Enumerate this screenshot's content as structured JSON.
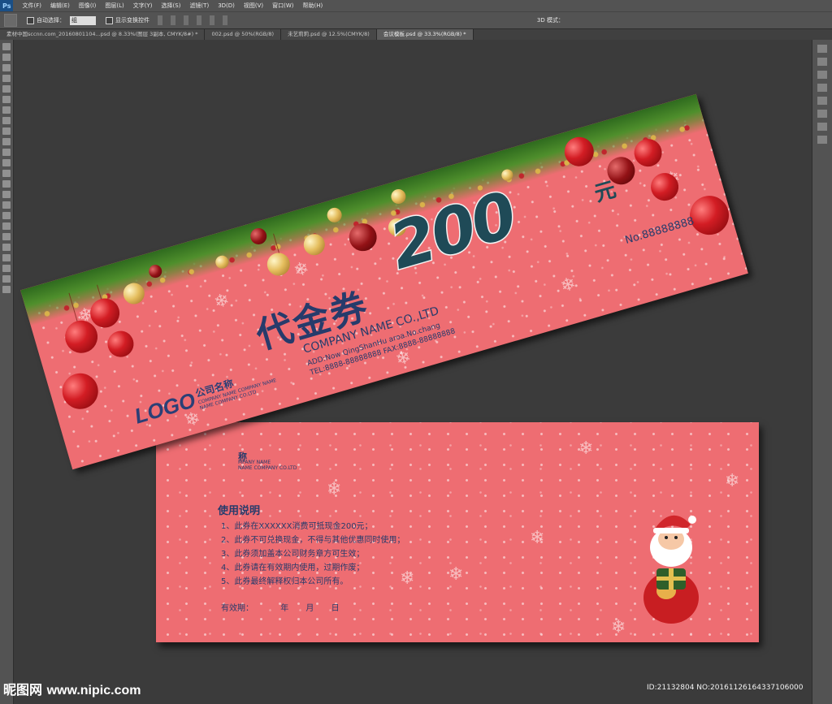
{
  "app": {
    "logo": "Ps",
    "menu": [
      "文件(F)",
      "编辑(E)",
      "图像(I)",
      "图层(L)",
      "文字(Y)",
      "选择(S)",
      "滤镜(T)",
      "3D(D)",
      "视图(V)",
      "窗口(W)",
      "帮助(H)"
    ]
  },
  "options_bar": {
    "auto_select_label": "自动选择：",
    "auto_select_value": "组",
    "show_transform_label": "显示变换控件",
    "mode_3d_label": "3D 模式："
  },
  "tabs": [
    {
      "label": "素材中国sccnn.com_20160801104...psd @ 8.33%(图层 3副本, CMYK/8#) *",
      "active": false
    },
    {
      "label": "002.psd @ 50%(RGB/8)",
      "active": false
    },
    {
      "label": "未艺莉莉.psd @ 12.5%(CMYK/8)",
      "active": false
    },
    {
      "label": "会议模板.psd @ 33.3%(RGB/8) *",
      "active": true
    }
  ],
  "voucher_front": {
    "title": "代金券",
    "amount": "200",
    "unit": "元",
    "serial": "No.88888888",
    "company_en": "COMPANY NAME CO.,LTD",
    "address": "ADD:Now QingShanHu aroa.No.chang",
    "phone_fax": "TEL:8888-88888888   FAX:8888-88888888",
    "logo": "LOGO",
    "logo_company_cn": "公司名称",
    "logo_company_en_1": "COMPANY NAME COMPANY NAME",
    "logo_company_en_2": "NAME COMPANY CO.LTD"
  },
  "voucher_back": {
    "peek_cn": "称",
    "peek_en_1": "MPANY NAME",
    "peek_en_2": "NAME COMPANY CO.LTD",
    "usage_title": "使用说明",
    "rules": [
      "1、此券在XXXXXX消费可抵现金200元；",
      "2、此券不可兑换现金，不得与其他优惠同时使用；",
      "3、此券须加盖本公司财务章方可生效；",
      "4、此券请在有效期内使用，过期作废；",
      "5、此券最终解释权归本公司所有。"
    ],
    "validity_label": "有效期：",
    "validity_year": "年",
    "validity_month": "月",
    "validity_day": "日"
  },
  "watermark": {
    "brand": "昵图网",
    "url": "www.nipic.com",
    "id_text": "ID:21132804 NO:20161126164337106000"
  },
  "colors": {
    "voucher_bg": "#ee6d72",
    "text_navy": "#273b6b",
    "amount_teal": "#1f4a57",
    "ui_gray": "#535353"
  }
}
